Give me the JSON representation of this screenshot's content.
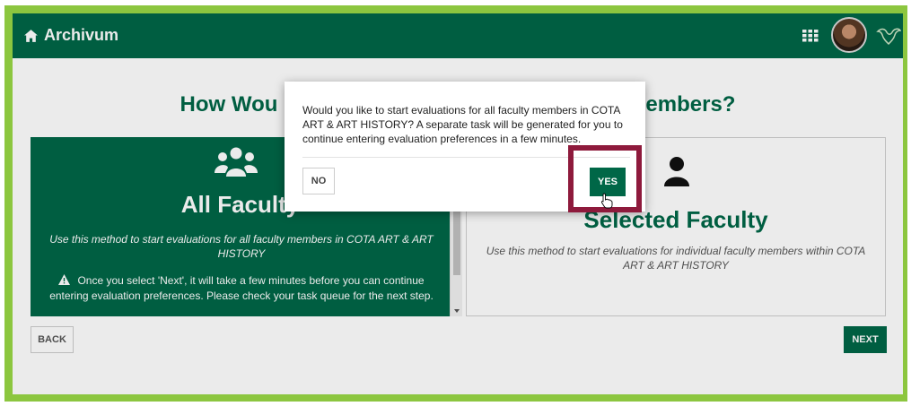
{
  "app": {
    "title": "Archivum"
  },
  "page": {
    "title_left": "How Wou",
    "title_right": "embers?"
  },
  "cards": {
    "all": {
      "title": "All Faculty",
      "description": "Use this method to start evaluations for all faculty members in COTA ART & ART HISTORY",
      "warning": "Once you select 'Next', it will take a few minutes before you can continue entering evaluation preferences. Please check your task queue for the next step."
    },
    "selected": {
      "title": "Selected Faculty",
      "description": "Use this method to start evaluations for individual faculty members within COTA ART & ART HISTORY"
    }
  },
  "nav": {
    "back_label": "BACK",
    "next_label": "NEXT"
  },
  "modal": {
    "message": "Would you like to start evaluations for all faculty members in COTA ART & ART HISTORY? A separate task will be generated for you to continue entering evaluation preferences in a few minutes.",
    "no_label": "NO",
    "yes_label": "YES"
  },
  "colors": {
    "brand_green": "#006747",
    "frame_green": "#8cc63f",
    "highlight": "#8e1a3c"
  },
  "icons": [
    "home-icon",
    "apps-grid-icon",
    "avatar",
    "bull-logo-icon",
    "group-icon",
    "person-icon",
    "warning-icon",
    "hand-cursor-icon"
  ]
}
